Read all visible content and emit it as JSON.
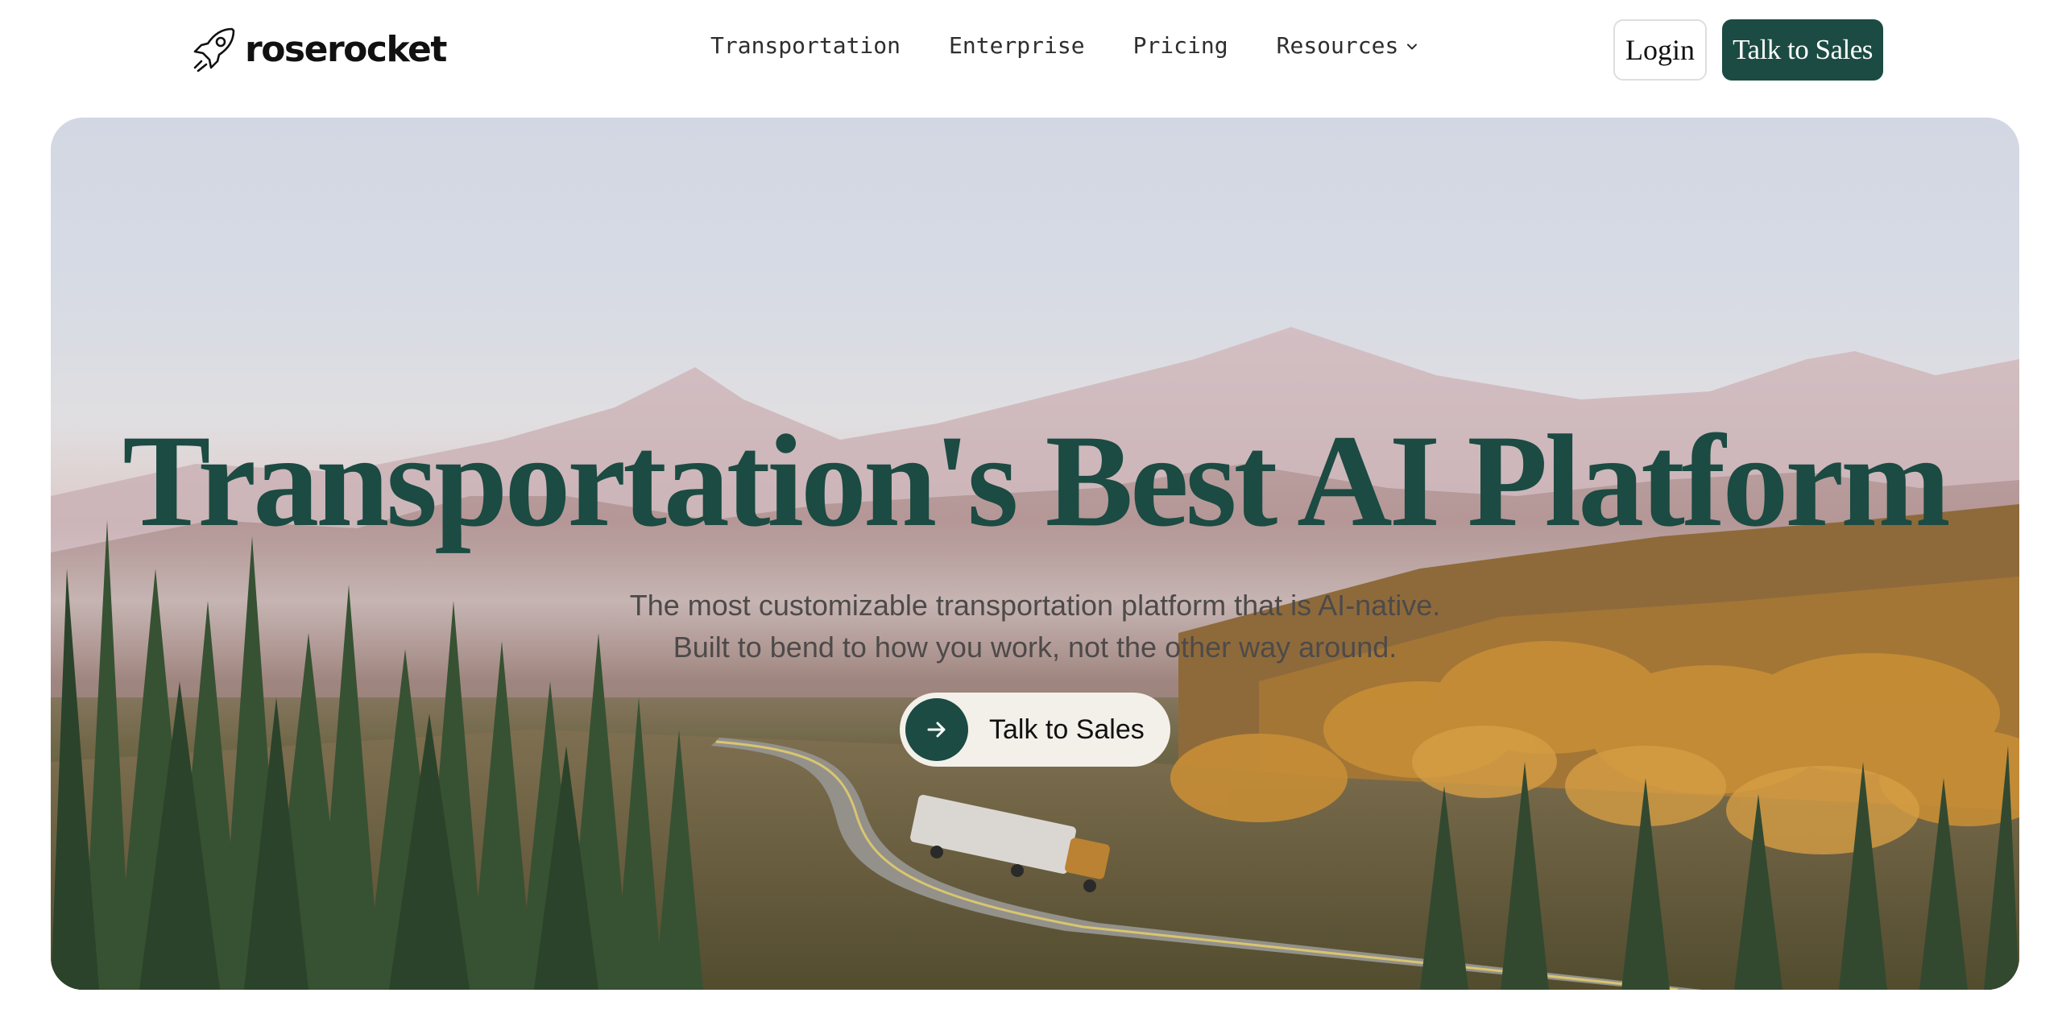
{
  "brand": {
    "name": "roserocket",
    "logo_icon": "rocket-icon"
  },
  "nav": {
    "links": [
      {
        "label": "Transportation"
      },
      {
        "label": "Enterprise"
      },
      {
        "label": "Pricing"
      },
      {
        "label": "Resources",
        "icon": "chevron-down-icon"
      }
    ],
    "login_label": "Login",
    "sales_label": "Talk to Sales"
  },
  "hero": {
    "title": "Transportation's Best AI Platform",
    "subtitle_line1": "The most customizable transportation platform that is AI-native.",
    "subtitle_line2": "Built to bend to how you work, not the other way around.",
    "cta_label": "Talk to Sales",
    "cta_icon": "arrow-right-icon"
  },
  "colors": {
    "brand_green": "#1b4b42",
    "cta_background": "#f3f0ea",
    "text_dark": "#111111"
  }
}
